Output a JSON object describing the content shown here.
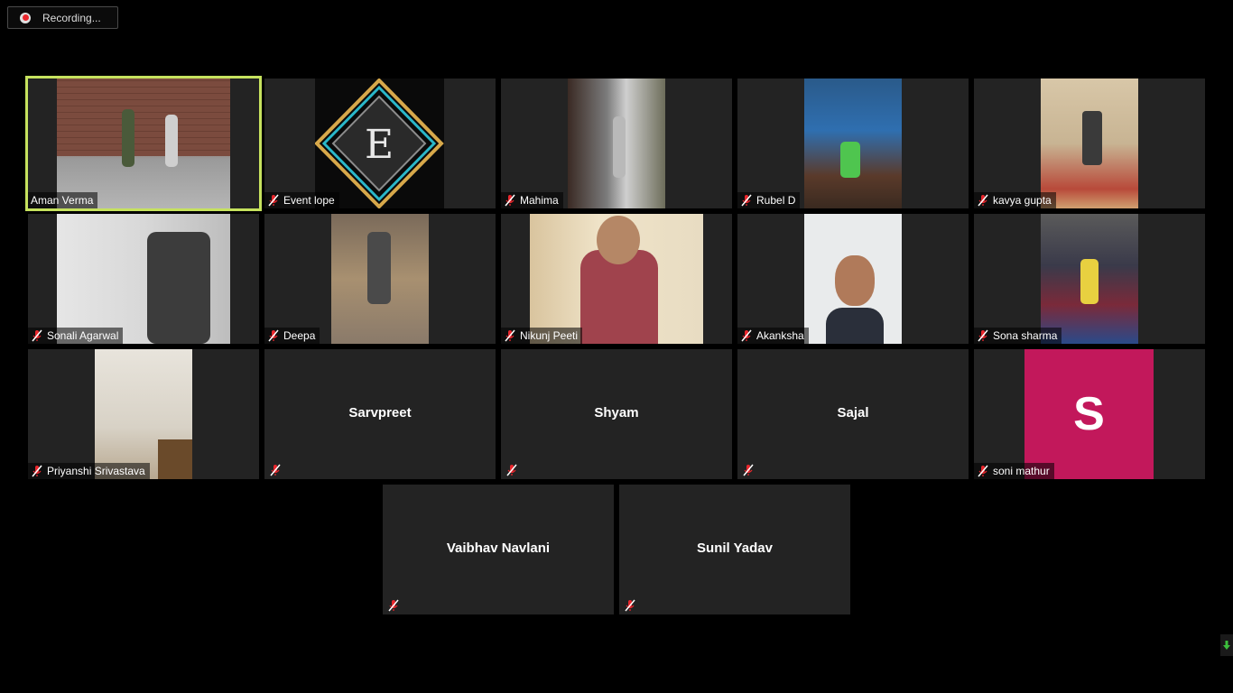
{
  "recording": {
    "label": "Recording..."
  },
  "tiles": [
    {
      "name": "Aman Verma",
      "muted": false,
      "active": true
    },
    {
      "name": "Event lope",
      "muted": true
    },
    {
      "name": "Mahima",
      "muted": true
    },
    {
      "name": "Rubel D",
      "muted": true
    },
    {
      "name": "kavya gupta",
      "muted": true
    },
    {
      "name": "Sonali Agarwal",
      "muted": true
    },
    {
      "name": "Deepa",
      "muted": true
    },
    {
      "name": "Nikunj Peeti",
      "muted": true
    },
    {
      "name": "Akanksha",
      "muted": true
    },
    {
      "name": "Sona sharma",
      "muted": true
    },
    {
      "name": "Priyanshi Srivastava",
      "muted": true
    },
    {
      "name": "Sarvpreet",
      "muted": true
    },
    {
      "name": "Shyam",
      "muted": true
    },
    {
      "name": "Sajal",
      "muted": true
    },
    {
      "name": "soni mathur",
      "muted": true,
      "avatar_letter": "S"
    },
    {
      "name": "Vaibhav Navlani",
      "muted": true
    },
    {
      "name": "Sunil Yadav",
      "muted": true
    }
  ],
  "logo_letter": "E",
  "colors": {
    "active_border": "#c6e25e",
    "avatar_bg": "#c2185b",
    "mute_red": "#e8262c"
  },
  "icons": {
    "mute": "microphone-muted-icon",
    "recording": "record-dot-icon",
    "scroll": "arrow-down-icon"
  }
}
